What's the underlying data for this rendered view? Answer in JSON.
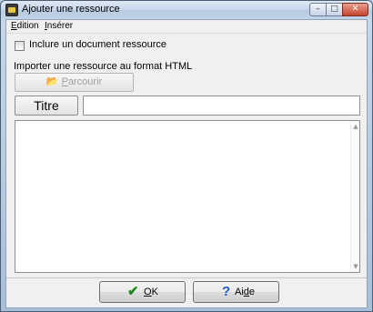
{
  "window": {
    "title": "Ajouter une ressource",
    "minimize_glyph": "–",
    "maximize_glyph": "□",
    "close_glyph": "✕"
  },
  "menubar": {
    "items": [
      {
        "mnemonic": "E",
        "rest": "dition"
      },
      {
        "mnemonic": "I",
        "rest": "nsérer"
      }
    ]
  },
  "form": {
    "include_checkbox": {
      "label": "Inclure un document ressource",
      "checked": false
    },
    "import_label": "Importer une ressource au format HTML",
    "browse_button": {
      "icon": "folder-icon",
      "glyph": "📂",
      "mnemonic": "P",
      "rest": "arcourir",
      "enabled": false
    },
    "titre_button_label": "Titre",
    "titre_value": "",
    "content_value": ""
  },
  "buttons": {
    "ok": {
      "glyph": "✔",
      "mnemonic": "O",
      "rest": "K"
    },
    "aide": {
      "glyph": "?",
      "before": "Ai",
      "mnemonic": "d",
      "rest": "e"
    }
  },
  "colors": {
    "ok_check": "#1e8c1e",
    "help_icon": "#1f5bc7"
  }
}
